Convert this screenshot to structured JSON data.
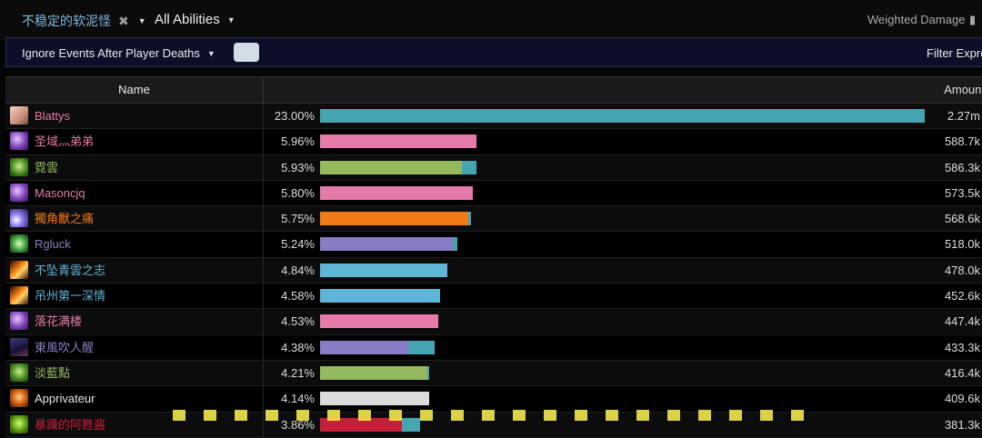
{
  "toolbar": {
    "target_label": "不稳定的软泥怪",
    "target_clear_glyph": "✖",
    "abilities_label": "All Abilities",
    "weighted_damage_label": "Weighted Damage",
    "ignore_events_label": "Ignore Events After Player Deaths",
    "filter_expression_label": "Filter Expre"
  },
  "table": {
    "header_name": "Name",
    "header_amount": "Amount"
  },
  "colors": {
    "mage": "#5fb5d6",
    "paladin": "#e67bab",
    "hunter": "#95ba5d",
    "warlock": "#8a7cc4",
    "druid": "#f07a16",
    "priest": "#dcdcdc",
    "dk": "#c81e3a",
    "extra": "#45a6b2"
  },
  "rows": [
    {
      "name": "Blattys",
      "pct": "23.00%",
      "amount": "2.27m",
      "share": 1.0,
      "extra": 0.0,
      "class": "paladin",
      "name_color": "#e67bab",
      "bar_color": "#45a6b2",
      "icon": "blood-elf-female-portrait-icon"
    },
    {
      "name": "圣域灬弟弟",
      "pct": "5.96%",
      "amount": "588.7k",
      "share": 0.259,
      "extra": 0.0,
      "class": "paladin",
      "name_color": "#e67bab",
      "bar_color": "#e67bab",
      "icon": "paladin-spell-icon"
    },
    {
      "name": "霓雲",
      "pct": "5.93%",
      "amount": "586.3k",
      "share": 0.235,
      "extra": 0.023,
      "class": "hunter",
      "name_color": "#95ba5d",
      "bar_color": "#95ba5d",
      "icon": "hunter-spell-icon"
    },
    {
      "name": "Masoncjq",
      "pct": "5.80%",
      "amount": "573.5k",
      "share": 0.252,
      "extra": 0.0,
      "class": "paladin",
      "name_color": "#e67bab",
      "bar_color": "#e67bab",
      "icon": "paladin-spell-icon"
    },
    {
      "name": "獨角獸之痛",
      "pct": "5.75%",
      "amount": "568.6k",
      "share": 0.245,
      "extra": 0.004,
      "class": "druid",
      "name_color": "#f07a16",
      "bar_color": "#f07a16",
      "icon": "druid-spell-icon"
    },
    {
      "name": "Rgluck",
      "pct": "5.24%",
      "amount": "518.0k",
      "share": 0.219,
      "extra": 0.008,
      "class": "warlock",
      "name_color": "#8a7cc4",
      "bar_color": "#8a7cc4",
      "icon": "warlock-spell-icon"
    },
    {
      "name": "不坠青雲之志",
      "pct": "4.84%",
      "amount": "478.0k",
      "share": 0.21,
      "extra": 0.0,
      "class": "mage",
      "name_color": "#5fb5d6",
      "bar_color": "#5fb5d6",
      "icon": "fire-spell-icon"
    },
    {
      "name": "吊州第一深情",
      "pct": "4.58%",
      "amount": "452.6k",
      "share": 0.198,
      "extra": 0.0,
      "class": "mage",
      "name_color": "#5fb5d6",
      "bar_color": "#5fb5d6",
      "icon": "fire-spell-icon"
    },
    {
      "name": "落花满楼",
      "pct": "4.53%",
      "amount": "447.4k",
      "share": 0.195,
      "extra": 0.0,
      "class": "paladin",
      "name_color": "#e67bab",
      "bar_color": "#e67bab",
      "icon": "paladin-spell-icon"
    },
    {
      "name": "東風吹人醒",
      "pct": "4.38%",
      "amount": "433.3k",
      "share": 0.146,
      "extra": 0.043,
      "class": "warlock",
      "name_color": "#8a7cc4",
      "bar_color": "#8a7cc4",
      "icon": "warlock-portrait-icon"
    },
    {
      "name": "淡藍點",
      "pct": "4.21%",
      "amount": "416.4k",
      "share": 0.177,
      "extra": 0.003,
      "class": "hunter",
      "name_color": "#95ba5d",
      "bar_color": "#95ba5d",
      "icon": "hunter-spell-icon"
    },
    {
      "name": "Apprivateur",
      "pct": "4.14%",
      "amount": "409.6k",
      "share": 0.18,
      "extra": 0.0,
      "class": "priest",
      "name_color": "#e8e8e8",
      "bar_color": "#dcdcdc",
      "icon": "priest-skull-icon"
    },
    {
      "name": "暴躁的阿甦酱",
      "pct": "3.86%",
      "amount": "381.3k",
      "share": 0.135,
      "extra": 0.03,
      "class": "dk",
      "name_color": "#c81e3a",
      "bar_color": "#c81e3a",
      "icon": "death-knight-spell-icon"
    }
  ]
}
